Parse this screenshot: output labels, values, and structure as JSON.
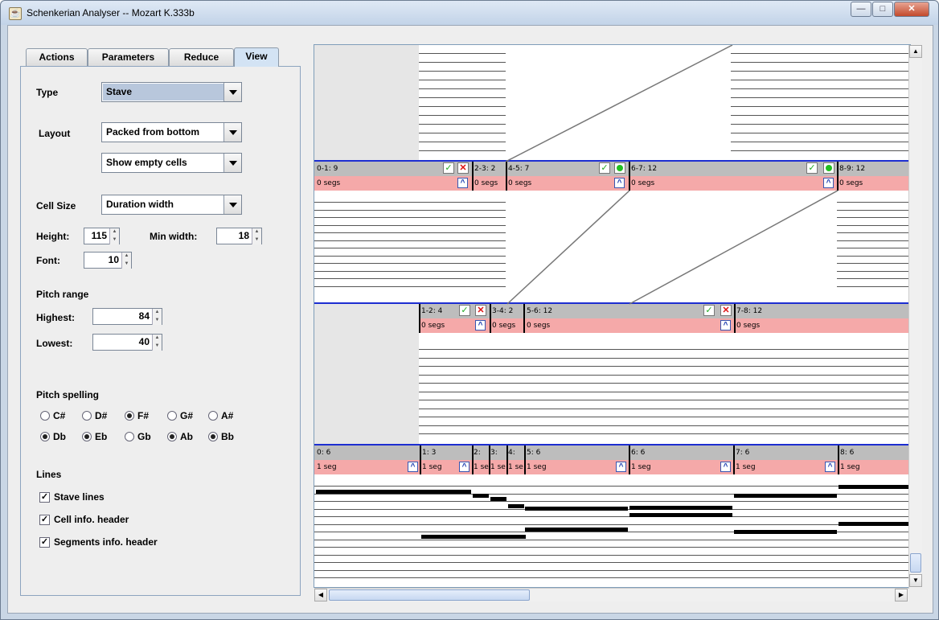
{
  "window": {
    "title": "Schenkerian Analyser -- Mozart K.333b"
  },
  "tabs": [
    {
      "label": "Actions"
    },
    {
      "label": "Parameters"
    },
    {
      "label": "Reduce"
    },
    {
      "label": "View"
    }
  ],
  "view_panel": {
    "type_label": "Type",
    "type_value": "Stave",
    "layout_label": "Layout",
    "layout_value": "Packed from bottom",
    "empty_cells_value": "Show empty cells",
    "cell_size_label": "Cell Size",
    "cell_size_value": "Duration width",
    "height_label": "Height:",
    "height_value": "115",
    "min_width_label": "Min width:",
    "min_width_value": "18",
    "font_label": "Font:",
    "font_value": "10",
    "pitch_range_label": "Pitch range",
    "highest_label": "Highest:",
    "highest_value": "84",
    "lowest_label": "Lowest:",
    "lowest_value": "40",
    "pitch_spelling_label": "Pitch spelling",
    "sharps": [
      {
        "label": "C#",
        "selected": false
      },
      {
        "label": "D#",
        "selected": false
      },
      {
        "label": "F#",
        "selected": true
      },
      {
        "label": "G#",
        "selected": false
      },
      {
        "label": "A#",
        "selected": false
      }
    ],
    "flats": [
      {
        "label": "Db",
        "selected": true
      },
      {
        "label": "Eb",
        "selected": true
      },
      {
        "label": "Gb",
        "selected": false
      },
      {
        "label": "Ab",
        "selected": true
      },
      {
        "label": "Bb",
        "selected": true
      }
    ],
    "lines_label": "Lines",
    "lines": [
      {
        "label": "Stave lines",
        "checked": true
      },
      {
        "label": "Cell info. header",
        "checked": true
      },
      {
        "label": "Segments info. header",
        "checked": true
      }
    ]
  },
  "stave_view": {
    "row1_cells": [
      {
        "info": "0-1: 9",
        "segs": "0 segs"
      },
      {
        "info": "2-3: 2",
        "segs": "0 segs"
      },
      {
        "info": "4-5: 7",
        "segs": "0 segs"
      },
      {
        "info": "6-7: 12",
        "segs": "0 segs"
      },
      {
        "info": "8-9: 12",
        "segs": "0 segs"
      }
    ],
    "row2_cells": [
      {
        "info": "1-2: 4",
        "segs": "0 segs"
      },
      {
        "info": "3-4: 2",
        "segs": "0 segs"
      },
      {
        "info": "5-6: 12",
        "segs": "0 segs"
      },
      {
        "info": "7-8: 12",
        "segs": "0 segs"
      }
    ],
    "row3_cells": [
      {
        "info": "0: 6",
        "segs": "1 seg"
      },
      {
        "info": "1: 3",
        "segs": "1 seg"
      },
      {
        "info": "2:",
        "segs": "1 se"
      },
      {
        "info": "3:",
        "segs": "1 se"
      },
      {
        "info": "4:",
        "segs": "1 se"
      },
      {
        "info": "5: 6",
        "segs": "1 seg"
      },
      {
        "info": "6: 6",
        "segs": "1 seg"
      },
      {
        "info": "7: 6",
        "segs": "1 seg"
      },
      {
        "info": "8: 6",
        "segs": "1 seg"
      }
    ]
  }
}
